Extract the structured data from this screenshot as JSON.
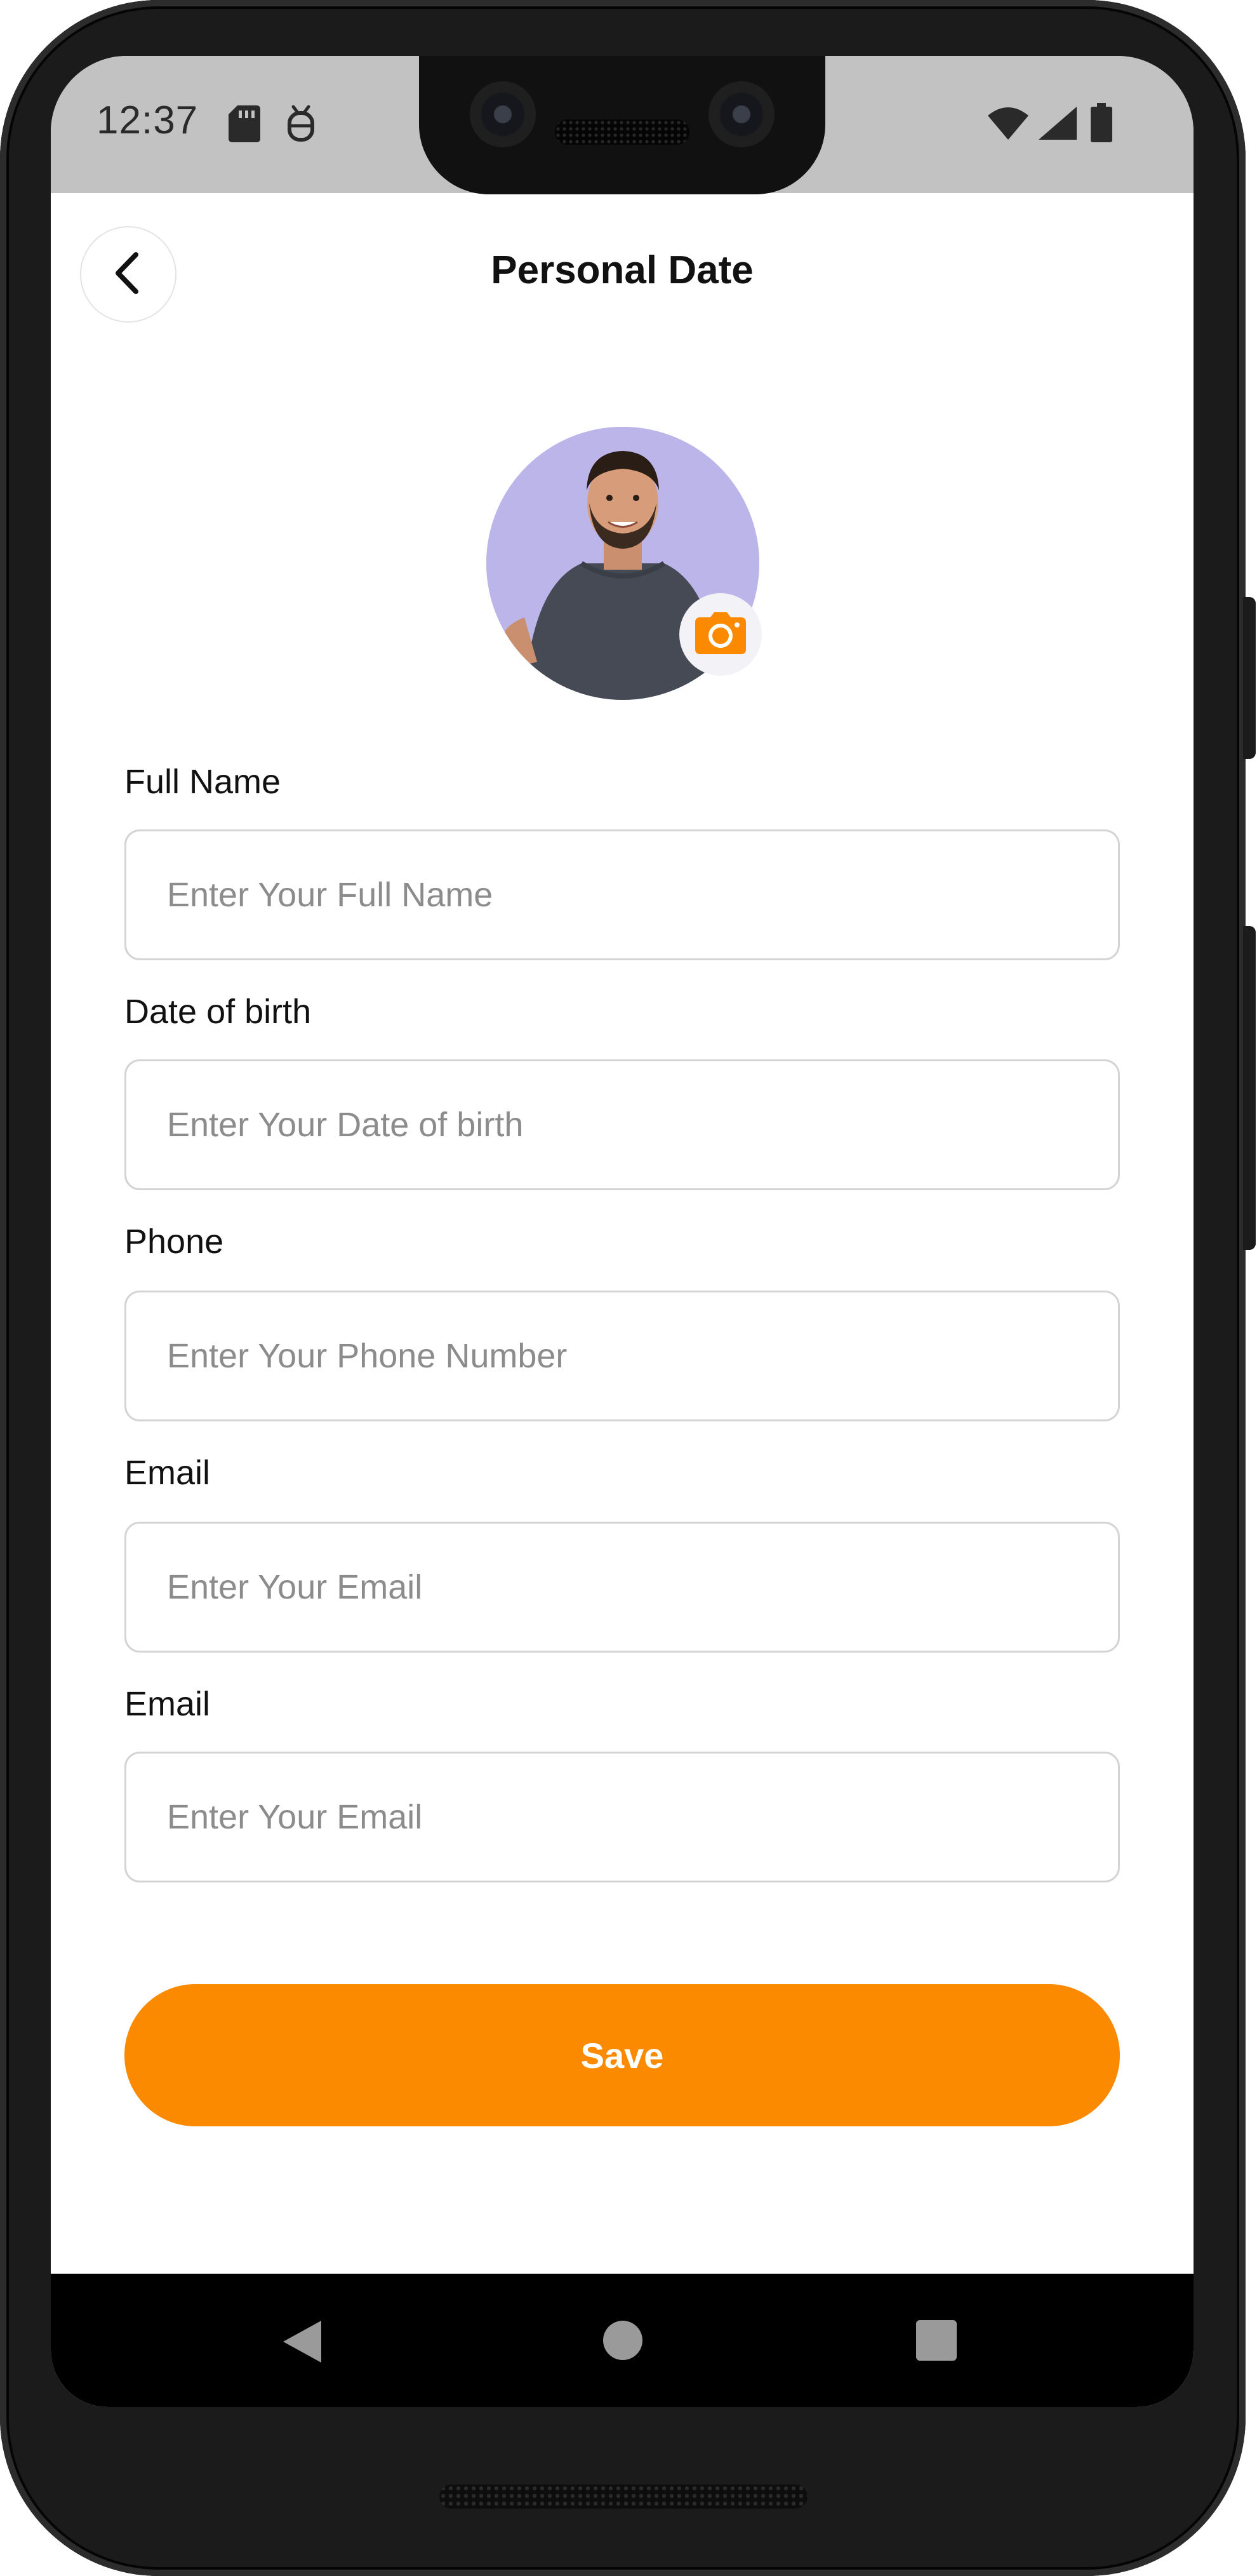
{
  "status_bar": {
    "time": "12:37",
    "icons": [
      "sd-card-icon",
      "bug-icon",
      "wifi-icon",
      "signal-icon",
      "battery-icon"
    ]
  },
  "header": {
    "title": "Personal Date",
    "back_icon": "chevron-left-icon"
  },
  "avatar": {
    "badge_icon": "camera-icon",
    "badge_color": "#fb8a00",
    "background_color": "#bcb5ea"
  },
  "form": {
    "fields": [
      {
        "label": "Full Name",
        "placeholder": "Enter Your Full Name"
      },
      {
        "label": "Date of birth",
        "placeholder": "Enter Your Date of birth"
      },
      {
        "label": "Phone",
        "placeholder": "Enter Your Phone Number"
      },
      {
        "label": "Email",
        "placeholder": "Enter Your Email"
      },
      {
        "label": "Email",
        "placeholder": "Enter Your Email"
      }
    ],
    "save_label": "Save",
    "accent_color": "#fb8a00"
  },
  "nav_bar": {
    "buttons": [
      "triangle-back-icon",
      "circle-home-icon",
      "square-recents-icon"
    ]
  }
}
